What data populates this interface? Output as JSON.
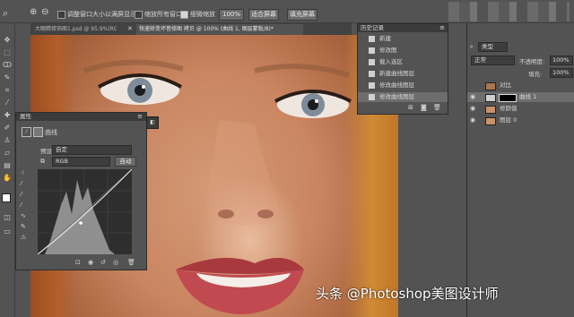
{
  "options_bar": {
    "resize_windows_label": "调整窗口大小以满屏显示",
    "zoom_all_windows_label": "缩放所有窗口",
    "scrubby_zoom_label": "细微缩放",
    "zoom_value": "100%",
    "fit_screen_label": "适合屏幕",
    "fill_screen_label": "填充屏幕"
  },
  "document_tabs": [
    {
      "label": "大眼睛修饰图1.psd @ 95.9%(RGB/8#)"
    },
    {
      "label": "快速矫变坏皆修图 拷贝 @ 100% (曲线 1, 图层蒙版/8)*"
    }
  ],
  "properties_panel": {
    "title": "属性",
    "section_label": "曲线",
    "preset_label": "预设:",
    "preset_value": "自定",
    "channel_value": "RGB",
    "auto_label": "自动"
  },
  "history_panel": {
    "title": "历史记录",
    "items": [
      "新建",
      "修改图",
      "载入选区",
      "新建曲线图层",
      "修改曲线图层",
      "修改曲线图层"
    ]
  },
  "layers_panel": {
    "kind_label": "类型",
    "blend_mode": "正常",
    "opacity_label": "不透明度:",
    "opacity_value": "100%",
    "fill_label": "填充:",
    "fill_value": "100%",
    "layers": [
      {
        "name": "对比"
      },
      {
        "name": "曲线 1"
      },
      {
        "name": "修颜值"
      },
      {
        "name": "图层 0"
      }
    ]
  },
  "watermark": "头条 @Photoshop美图设计师"
}
